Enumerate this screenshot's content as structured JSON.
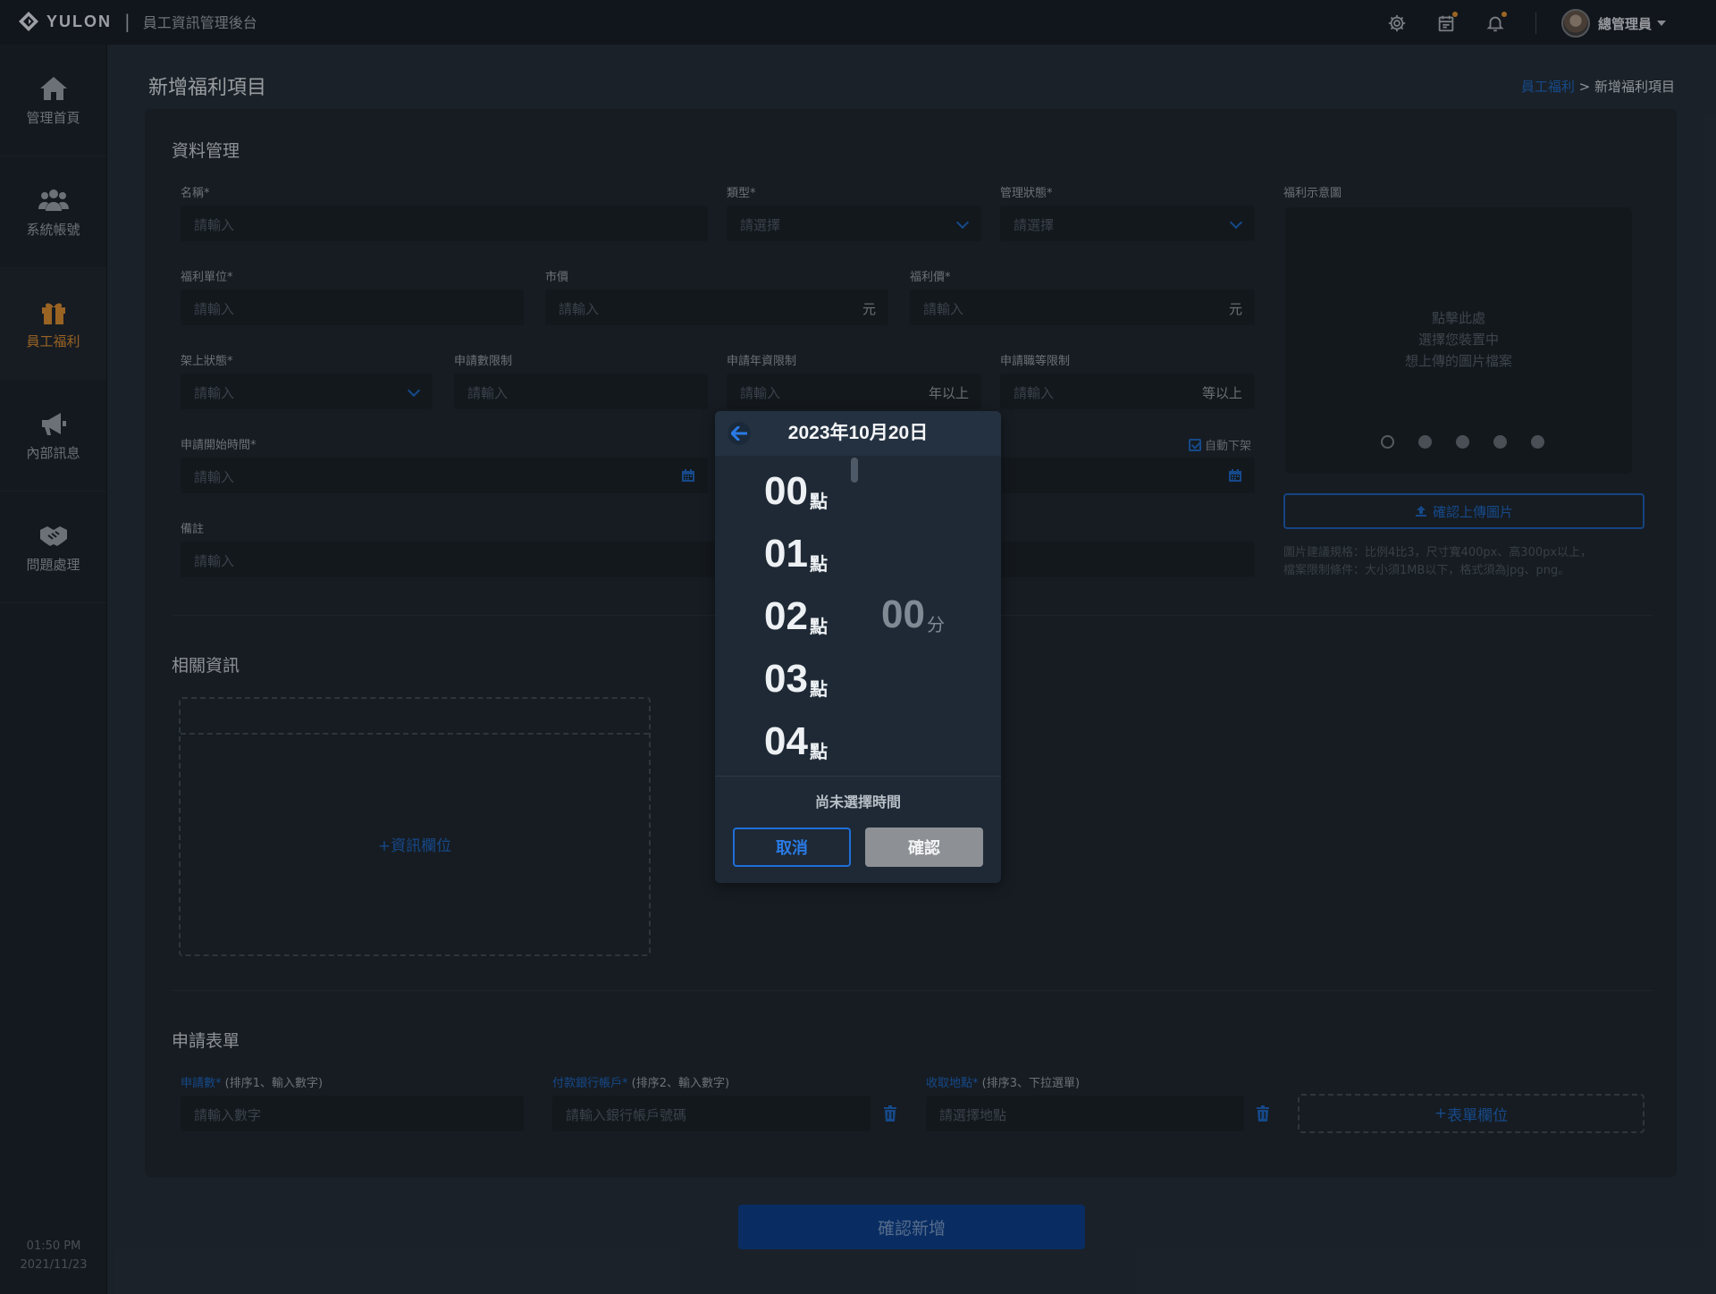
{
  "topbar": {
    "brand": "YULON",
    "separator": "|",
    "subtitle": "員工資訊管理後台",
    "user_name": "總管理員"
  },
  "sidebar": {
    "items": [
      {
        "label": "管理首頁",
        "icon": "home-icon"
      },
      {
        "label": "系統帳號",
        "icon": "users-icon"
      },
      {
        "label": "員工福利",
        "icon": "gift-icon",
        "active": true
      },
      {
        "label": "內部訊息",
        "icon": "megaphone-icon"
      },
      {
        "label": "問題處理",
        "icon": "handshake-icon"
      }
    ],
    "time": "01:50 PM",
    "date": "2021/11/23"
  },
  "page": {
    "title": "新增福利項目",
    "breadcrumb_link": "員工福利",
    "breadcrumb_sep": ">",
    "breadcrumb_current": "新增福利項目"
  },
  "data_section": {
    "title": "資料管理",
    "fields": {
      "name": {
        "label": "名稱*",
        "placeholder": "請輸入"
      },
      "type": {
        "label": "類型*",
        "placeholder": "請選擇"
      },
      "manage_status": {
        "label": "管理狀態*",
        "placeholder": "請選擇"
      },
      "unit": {
        "label": "福利單位*",
        "placeholder": "請輸入"
      },
      "market_price": {
        "label": "市價",
        "placeholder": "請輸入",
        "suffix": "元"
      },
      "benefit_price": {
        "label": "福利價*",
        "placeholder": "請輸入",
        "suffix": "元"
      },
      "shelf_status": {
        "label": "架上狀態*",
        "placeholder": "請輸入"
      },
      "apply_limit": {
        "label": "申請數限制",
        "placeholder": "請輸入"
      },
      "seniority_limit": {
        "label": "申請年資限制",
        "placeholder": "請輸入",
        "suffix": "年以上"
      },
      "rank_limit": {
        "label": "申請職等限制",
        "placeholder": "請輸入",
        "suffix": "等以上"
      },
      "start_time": {
        "label": "申請開始時間*",
        "placeholder": "請輸入"
      },
      "remark": {
        "label": "備註",
        "placeholder": "請輸入"
      }
    },
    "auto_off_shelf": "自動下架"
  },
  "image_panel": {
    "label": "福利示意圖",
    "upload_line1": "點擊此處",
    "upload_line2": "選擇您裝置中",
    "upload_line3": "想上傳的圖片檔案",
    "confirm_upload": "確認上傳圖片",
    "note_line1": "圖片建議規格：比例4比3，尺寸寬400px、高300px以上，",
    "note_line2": "檔案限制條件：大小須1MB以下，格式須為jpg、png。"
  },
  "related_section": {
    "title": "相關資訊",
    "add_field": "資訊欄位"
  },
  "application_section": {
    "title": "申請表單",
    "fields": [
      {
        "label_req": "申請數*",
        "label_hint": " (排序1、輸入數字)",
        "placeholder": "請輸入數字"
      },
      {
        "label_req": "付款銀行帳戶*",
        "label_hint": " (排序2、輸入數字)",
        "placeholder": "請輸入銀行帳戶號碼"
      },
      {
        "label_req": "收取地點*",
        "label_hint": " (排序3、下拉選單)",
        "placeholder": "請選擇地點"
      }
    ],
    "add_field": "表單欄位"
  },
  "submit_label": "確認新增",
  "time_picker": {
    "date_title": "2023年10月20日",
    "hour_unit": "點",
    "minute_unit": "分",
    "hours": [
      "00",
      "01",
      "02",
      "03",
      "04"
    ],
    "minute": "00",
    "status": "尚未選擇時間",
    "cancel": "取消",
    "confirm": "確認"
  },
  "colors": {
    "accent_blue": "#1d5eb0",
    "active_orange": "#c47f2e",
    "badge_orange": "#c9822e"
  }
}
